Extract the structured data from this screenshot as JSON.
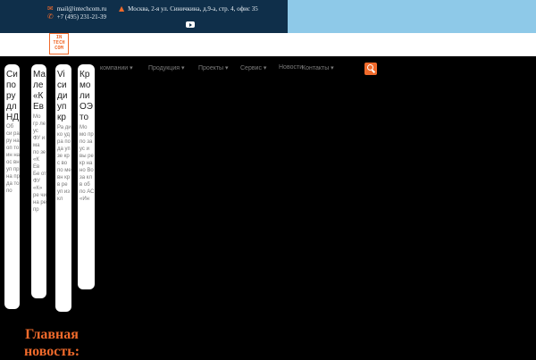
{
  "contacts": {
    "email": "mail@intechcom.ru",
    "address": "Москва, 2-я ул. Синичкина, д.9-а, стр. 4, офис 35",
    "phone": "+7 (495) 231-21-39"
  },
  "icons": {
    "email": "mail-icon",
    "address": "location-pin-icon",
    "phone": "phone-icon",
    "social": "youtube-icon",
    "search": "search-icon"
  },
  "logo": {
    "line1": "IN",
    "line2": "TECH",
    "line3": "COM"
  },
  "nav": {
    "items": [
      "компании ▾",
      "Продукция ▾",
      "Проекты ▾",
      "Сервис ▾",
      "Новости",
      "Контакты ▾"
    ]
  },
  "cards": [
    {
      "title": "Си по ру дл НД",
      "body": "Об си ра ру на оп то ин на ос вн уп пр на пр да то по"
    },
    {
      "title": "Ма ле «К Ев",
      "body": "Мо гр ле ус ФУ и ма по зе «К Ев Бе от ФУ «К» ре чи на ре пр"
    },
    {
      "title": "Vi си ди уп кр",
      "body": "Ра ди ко уд ра по да уп зе кр с во по ме вн кр в ре уп из кл"
    },
    {
      "title": "Кр мо ли ОЭ то",
      "body": "Мо мо пр по за ус и вы ре кр на но Во за кл в об по АС «Ин"
    }
  ],
  "headline": {
    "line1": "Главная",
    "line2": "новость:"
  },
  "colors": {
    "accent": "#f06a2b",
    "topbar": "#0f2f4a",
    "topbar_light": "#8ec9e8"
  }
}
